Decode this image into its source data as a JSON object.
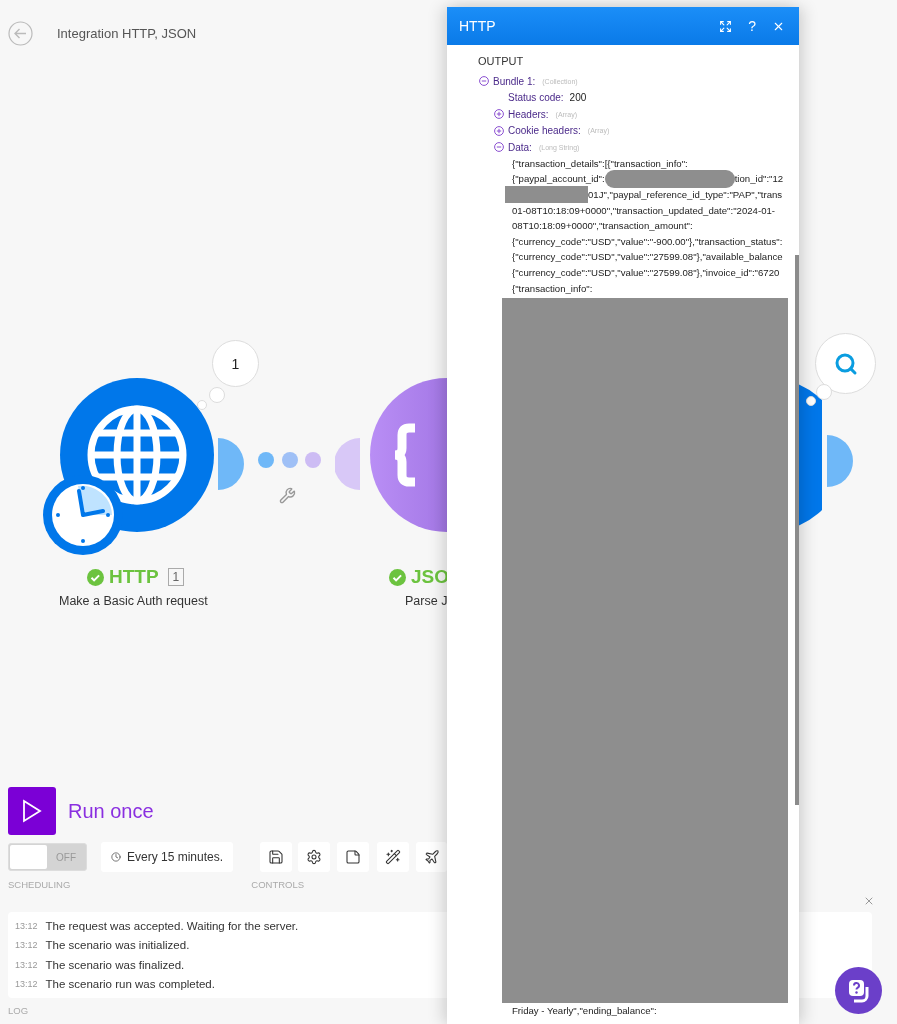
{
  "header": {
    "title": "Integration HTTP, JSON"
  },
  "canvas": {
    "modules": [
      {
        "kind": "http",
        "app": "HTTP",
        "description": "Make a Basic Auth request",
        "succeeded": true,
        "operations": "1",
        "bubble": "1"
      },
      {
        "kind": "json",
        "app": "JSO",
        "description": "Parse J",
        "succeeded": true
      },
      {
        "kind": "partial"
      }
    ]
  },
  "run": {
    "label": "Run once"
  },
  "scheduling": {
    "on": false,
    "toggle_label": "OFF",
    "interval": "Every 15 minutes.",
    "label": "SCHEDULING"
  },
  "controls": {
    "label": "CONTROLS",
    "buttons": [
      {
        "kind": "save"
      },
      {
        "kind": "settings"
      },
      {
        "kind": "notes"
      },
      {
        "kind": "autoalign"
      },
      {
        "kind": "flow"
      }
    ]
  },
  "log": {
    "label": "LOG",
    "entries": [
      {
        "time": "13:12",
        "message": "The request was accepted. Waiting for the server."
      },
      {
        "time": "13:12",
        "message": "The scenario was initialized."
      },
      {
        "time": "13:12",
        "message": "The scenario was finalized."
      },
      {
        "time": "13:12",
        "message": "The scenario run was completed."
      }
    ]
  },
  "panel": {
    "title": "HTTP",
    "help": "?",
    "section": "OUTPUT",
    "bundle": {
      "label": "Bundle 1:",
      "type": "(Collection)",
      "expanded": true,
      "items": [
        {
          "kind": "value",
          "label": "Status code:",
          "value": "200"
        },
        {
          "kind": "branch",
          "label": "Headers:",
          "type": "(Array)",
          "expanded": false
        },
        {
          "kind": "branch",
          "label": "Cookie headers:",
          "type": "(Array)",
          "expanded": false
        },
        {
          "kind": "branch",
          "label": "Data:",
          "type": "(Long String)",
          "expanded": true,
          "lines": [
            [
              {
                "kind": "text",
                "text": "{\"transaction_details\":[{\"transaction_info\":"
              }
            ],
            [
              {
                "kind": "text",
                "text": "{\"paypal_account_id\":"
              },
              {
                "kind": "pill"
              },
              {
                "kind": "text",
                "text": "tion_id\":\"12"
              }
            ],
            [
              {
                "kind": "bar"
              },
              {
                "kind": "text",
                "text": "01J\",\"paypal_reference_id_type\":\"PAP\",\"trans"
              }
            ],
            [
              {
                "kind": "text",
                "text": "01-08T10:18:09+0000\",\"transaction_updated_date\":\"2024-01-"
              }
            ],
            [
              {
                "kind": "text",
                "text": "08T10:18:09+0000\",\"transaction_amount\":"
              }
            ],
            [
              {
                "kind": "text",
                "text": "{\"currency_code\":\"USD\",\"value\":\"-900.00\"},\"transaction_status\":"
              }
            ],
            [
              {
                "kind": "text",
                "text": "{\"currency_code\":\"USD\",\"value\":\"27599.08\"},\"available_balance"
              }
            ],
            [
              {
                "kind": "text",
                "text": "{\"currency_code\":\"USD\",\"value\":\"27599.08\"},\"invoice_id\":\"6720"
              }
            ],
            [
              {
                "kind": "text",
                "text": "{\"transaction_info\":"
              }
            ],
            [
              {
                "kind": "block"
              }
            ],
            [
              {
                "kind": "text",
                "text": "Friday - Yearly\",\"ending_balance\":"
              }
            ]
          ]
        }
      ]
    }
  }
}
